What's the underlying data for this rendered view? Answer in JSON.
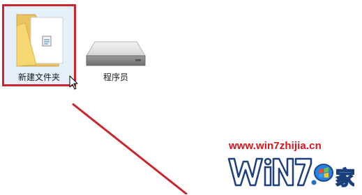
{
  "desktop": {
    "items": [
      {
        "label": "新建文件夹",
        "type": "folder",
        "selected": true
      },
      {
        "label": "程序员",
        "type": "drive",
        "selected": false
      }
    ]
  },
  "colors": {
    "highlight_border": "#c9252c",
    "selection_fill": "#e6f0fb",
    "arrow": "#c9252c",
    "watermark_red": "#d8131a",
    "watermark_blue": "#1f6fcf"
  },
  "watermark": {
    "url": "www.win7zhijia.cn",
    "logo_text": "Win7系统之家"
  }
}
